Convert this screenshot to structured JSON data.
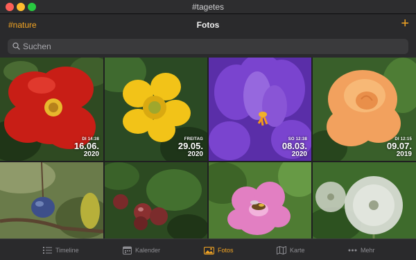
{
  "window": {
    "title": "#tagetes"
  },
  "nav": {
    "left_label": "#nature",
    "title": "Fotos",
    "add_symbol": "+"
  },
  "search": {
    "placeholder": "Suchen"
  },
  "photos": [
    {
      "subject": "red rose",
      "sub": "DI 14:38",
      "date": "16.06.",
      "year": "2020"
    },
    {
      "subject": "yellow buttercup",
      "sub": "FREITAG",
      "date": "29.05.",
      "year": "2020"
    },
    {
      "subject": "purple crocus",
      "sub": "SO 12:38",
      "date": "08.03.",
      "year": "2020"
    },
    {
      "subject": "orange rose",
      "sub": "DI 12:15",
      "date": "09.07.",
      "year": "2019"
    },
    {
      "subject": "plum on branch"
    },
    {
      "subject": "gooseberries"
    },
    {
      "subject": "pink flower with bee"
    },
    {
      "subject": "dandelion clocks"
    }
  ],
  "tabs": [
    {
      "label": "Timeline",
      "icon": "list-icon"
    },
    {
      "label": "Kalender",
      "icon": "calendar-icon"
    },
    {
      "label": "Fotos",
      "icon": "photo-icon",
      "active": true
    },
    {
      "label": "Karte",
      "icon": "map-icon"
    },
    {
      "label": "Mehr",
      "icon": "ellipsis-icon"
    }
  ],
  "colors": {
    "accent": "#f5a623",
    "background": "#1f1f21",
    "bar": "#2a2a2c"
  }
}
